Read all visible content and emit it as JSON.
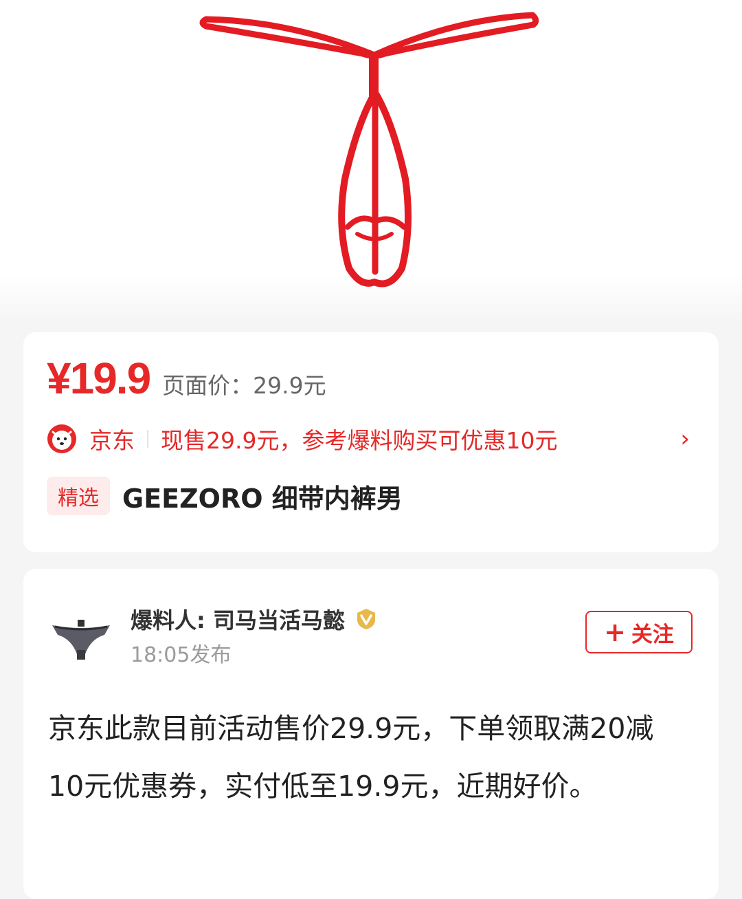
{
  "hero": {
    "image_name": "red-string-underwear-image",
    "product_color": "#e31b23"
  },
  "price_card": {
    "price": "¥19.9",
    "page_price": "页面价：29.9元",
    "store": {
      "icon": "jd-dog-icon",
      "name": "京东",
      "description": "现售29.9元，参考爆料购买可优惠10元",
      "arrow": "›"
    },
    "tag": "精选",
    "title": "GEEZORO 细带内裤男"
  },
  "author_card": {
    "author": "爆料人: 司马当活马懿",
    "verify_icon": "verified-v-icon",
    "time": "18:05发布",
    "follow": {
      "plus": "+",
      "label": "关注"
    },
    "content": "京东此款目前活动售价29.9元，下单领取满20减10元优惠券，实付低至19.9元，近期好价。"
  },
  "colors": {
    "accent": "#e62828",
    "background": "#f5f5f5",
    "tag_bg": "#fdeceb",
    "verify_gold": "#e8b84a"
  }
}
